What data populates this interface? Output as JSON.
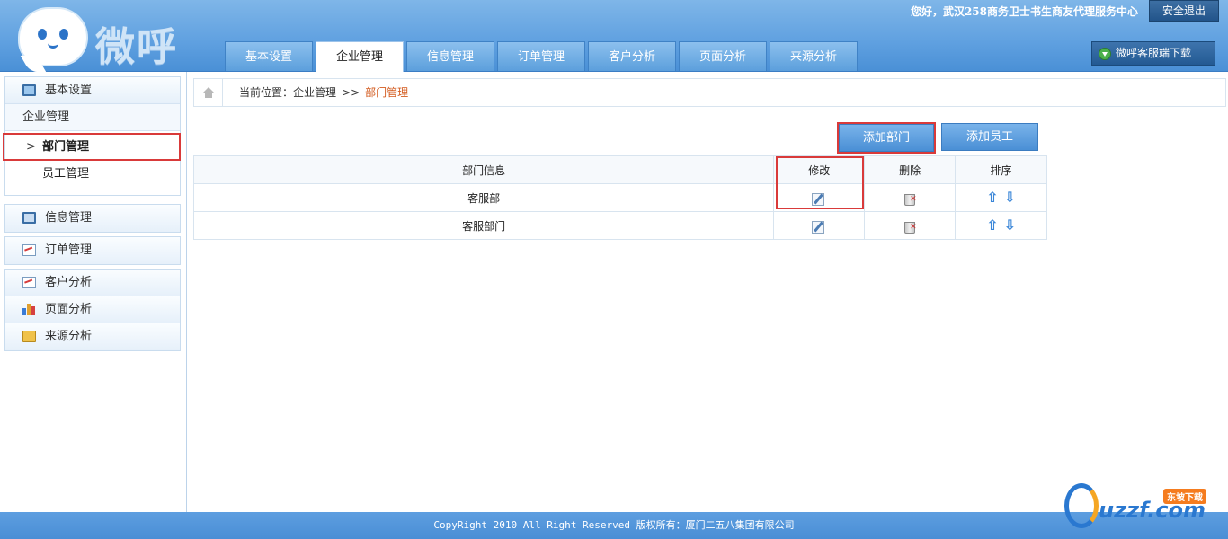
{
  "app": {
    "logo_text": "微呼"
  },
  "header": {
    "greeting": "您好，武汉258商务卫士书生商友代理服务中心",
    "logout_label": "安全退出",
    "download_label": "微呼客服端下载",
    "tabs": [
      "基本设置",
      "企业管理",
      "信息管理",
      "订单管理",
      "客户分析",
      "页面分析",
      "来源分析"
    ],
    "active_tab": "企业管理"
  },
  "sidebar": {
    "basic_settings": {
      "label": "基本设置",
      "icon": "monitor-icon"
    },
    "enterprise_header": "企业管理",
    "enterprise_items": [
      {
        "label": "部门管理",
        "active": true
      },
      {
        "label": "员工管理",
        "active": false
      }
    ],
    "info_mgmt": {
      "label": "信息管理",
      "icon": "info-icon"
    },
    "order_mgmt": {
      "label": "订单管理",
      "icon": "chart-icon"
    },
    "analysis": [
      {
        "label": "客户分析",
        "icon": "chart-icon"
      },
      {
        "label": "页面分析",
        "icon": "bar-chart-icon"
      },
      {
        "label": "来源分析",
        "icon": "folder-icon"
      }
    ]
  },
  "breadcrumb": {
    "prefix": "当前位置：",
    "parent": "企业管理",
    "separator": ">>",
    "current": "部门管理"
  },
  "actions": {
    "add_department": "添加部门",
    "add_employee": "添加员工"
  },
  "table": {
    "columns": [
      "部门信息",
      "修改",
      "删除",
      "排序"
    ],
    "rows": [
      {
        "name": "客服部"
      },
      {
        "name": "客服部门"
      }
    ]
  },
  "footer": {
    "text": "CopyRight 2010 All Right Reserved 版权所有：厦门二五八集团有限公司"
  },
  "watermark": {
    "text": "uzzf.com",
    "badge": "东坡下载"
  },
  "colors": {
    "header_blue": "#5fa0e0",
    "accent_red": "#d93a3a",
    "crumb_orange": "#d35b1f"
  }
}
